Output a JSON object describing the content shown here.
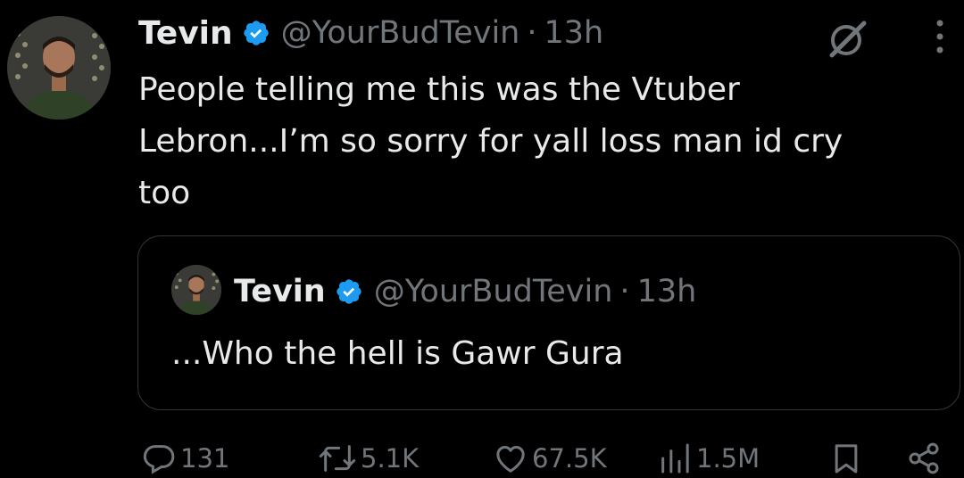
{
  "tweet": {
    "author": {
      "name": "Tevin",
      "handle": "@YourBudTevin"
    },
    "separator": "·",
    "time": "13h",
    "text": "People telling me this was the Vtuber\nLebron...I’m so sorry for yall loss man id cry\ntoo",
    "verified_color": "#1d9bf0"
  },
  "quoted": {
    "author": {
      "name": "Tevin",
      "handle": "@YourBudTevin"
    },
    "separator": "·",
    "time": "13h",
    "text": "...Who the hell is Gawr Gura"
  },
  "actions": {
    "replies": "131",
    "reposts": "5.1K",
    "likes": "67.5K",
    "views": "1.5M"
  },
  "icons": [
    "verified-badge-icon",
    "grok-icon",
    "more-icon",
    "reply-icon",
    "repost-icon",
    "like-icon",
    "views-icon",
    "bookmark-icon",
    "share-icon"
  ]
}
